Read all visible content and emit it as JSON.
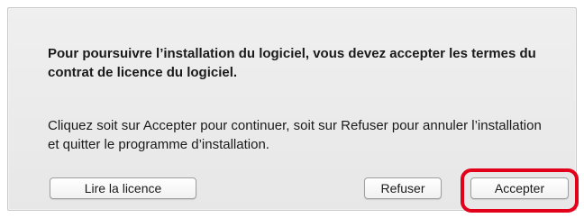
{
  "dialog": {
    "message": "Pour poursuivre l’installation du logiciel, vous devez accepter les termes du contrat de licence du logiciel.",
    "info": "Cliquez soit sur Accepter pour continuer, soit sur Refuser pour annuler l’installation et quitter le programme d’installation."
  },
  "buttons": {
    "read_license": "Lire la licence",
    "refuse": "Refuser",
    "accept": "Accepter"
  },
  "colors": {
    "highlight": "#e3001b"
  }
}
